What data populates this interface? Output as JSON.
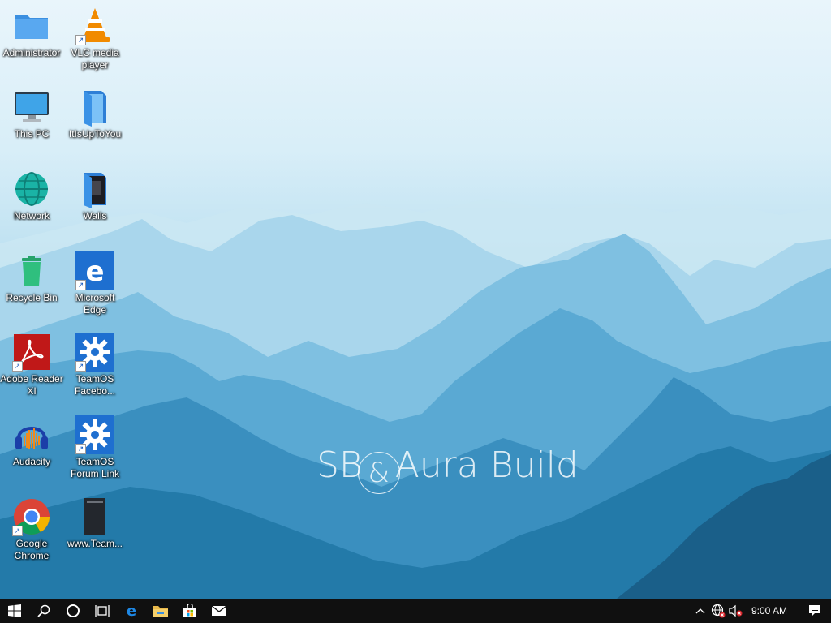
{
  "desktop": {
    "watermark": {
      "left": "SB",
      "amp": "&",
      "right": "Aura Build"
    },
    "icons": [
      {
        "label": "Administrator",
        "icon": "folder-icon"
      },
      {
        "label": "VLC media player",
        "icon": "vlc-icon",
        "shortcut": true
      },
      {
        "label": "This PC",
        "icon": "monitor-icon"
      },
      {
        "label": "ItIsUpToYou",
        "icon": "folder-blue-icon"
      },
      {
        "label": "Network",
        "icon": "network-globe-icon"
      },
      {
        "label": "Walls",
        "icon": "folder-walls-icon"
      },
      {
        "label": "Recycle Bin",
        "icon": "recycle-bin-icon"
      },
      {
        "label": "Microsoft Edge",
        "icon": "edge-icon",
        "shortcut": true
      },
      {
        "label": "Adobe Reader XI",
        "icon": "adobe-reader-icon",
        "shortcut": true
      },
      {
        "label": "TeamOS Facebo...",
        "icon": "gear-icon",
        "shortcut": true
      },
      {
        "label": "Audacity",
        "icon": "audacity-icon"
      },
      {
        "label": "TeamOS Forum Link",
        "icon": "gear-icon",
        "shortcut": true
      },
      {
        "label": "Google Chrome",
        "icon": "chrome-icon",
        "shortcut": true
      },
      {
        "label": "www.Team...",
        "icon": "document-dark-icon"
      }
    ]
  },
  "taskbar": {
    "pinned": [
      "start-button",
      "search-button",
      "cortana-button",
      "task-view-button",
      "edge-button",
      "file-explorer-button",
      "store-button",
      "mail-button"
    ],
    "clock": "9:00 AM",
    "colors": {
      "bar": "#101010",
      "accent": "#0078d7"
    }
  }
}
